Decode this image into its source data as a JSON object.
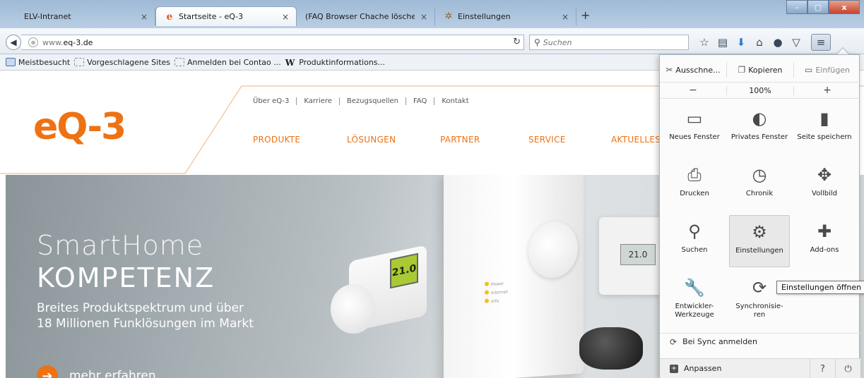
{
  "tabs": [
    {
      "title": "ELV-Intranet",
      "active": false,
      "favicon": "none"
    },
    {
      "title": "Startseite - eQ-3",
      "active": true,
      "favicon": "eq3-e-icon"
    },
    {
      "title": "(FAQ Browser Chache löschen ...",
      "active": false,
      "favicon": "none"
    },
    {
      "title": "Einstellungen",
      "active": false,
      "favicon": "gear-icon"
    }
  ],
  "tab_close_glyph": "×",
  "new_tab_glyph": "+",
  "window_controls": {
    "minimize": "–",
    "maximize": "▢",
    "close": "x"
  },
  "navbar": {
    "url_prefix": "www.",
    "url_domain": "eq-3.de",
    "search_placeholder": "Suchen"
  },
  "bookmarks": [
    {
      "label": "Meistbesucht",
      "icon": "solid"
    },
    {
      "label": "Vorgeschlagene Sites",
      "icon": "dashed"
    },
    {
      "label": "Anmelden bei Contao ...",
      "icon": "dashed"
    },
    {
      "label": "Produktinformations...",
      "icon": "wikipedia"
    }
  ],
  "bookmark_wiki_glyph": "W",
  "site": {
    "logo": "eQ-3",
    "top_nav": [
      "Über eQ-3",
      "Karriere",
      "Bezugsquellen",
      "FAQ",
      "Kontakt"
    ],
    "main_nav": [
      "PRODUKTE",
      "LÖSUNGEN",
      "PARTNER",
      "SERVICE",
      "AKTUELLES"
    ],
    "hero_title_1": "SmartHome",
    "hero_title_2": "KOMPETENZ",
    "hero_subtitle_1": "Breites Produktspektrum und über",
    "hero_subtitle_2": "18 Millionen Funklösungen im Markt",
    "hero_cta": "mehr erfahren",
    "gateway_leds": [
      "Power",
      "Internet",
      "Info"
    ],
    "thermostat_display": "21.0",
    "wall_display": "21.0",
    "brand_color": "#ee7213"
  },
  "menu": {
    "edit": {
      "cut": "Ausschne...",
      "copy": "Kopieren",
      "paste": "Einfügen"
    },
    "zoom": {
      "minus": "−",
      "value": "100%",
      "plus": "+"
    },
    "items": [
      {
        "label": "Neues Fenster",
        "icon": "new-window-icon"
      },
      {
        "label": "Privates Fenster",
        "icon": "private-mask-icon"
      },
      {
        "label": "Seite speichern",
        "icon": "save-page-icon"
      },
      {
        "label": "Drucken",
        "icon": "printer-icon"
      },
      {
        "label": "Chronik",
        "icon": "history-clock-icon"
      },
      {
        "label": "Vollbild",
        "icon": "fullscreen-icon"
      },
      {
        "label": "Suchen",
        "icon": "search-icon"
      },
      {
        "label": "Einstellungen",
        "icon": "settings-gear-icon"
      },
      {
        "label": "Add-ons",
        "icon": "puzzle-icon"
      },
      {
        "label": "Entwickler-Werkzeuge",
        "icon": "wrench-icon"
      },
      {
        "label": "Synchronisie-ren",
        "icon": "sync-icon"
      }
    ],
    "tooltip": "Einstellungen öffnen",
    "sync_login": "Bei Sync anmelden",
    "customize": "Anpassen"
  }
}
